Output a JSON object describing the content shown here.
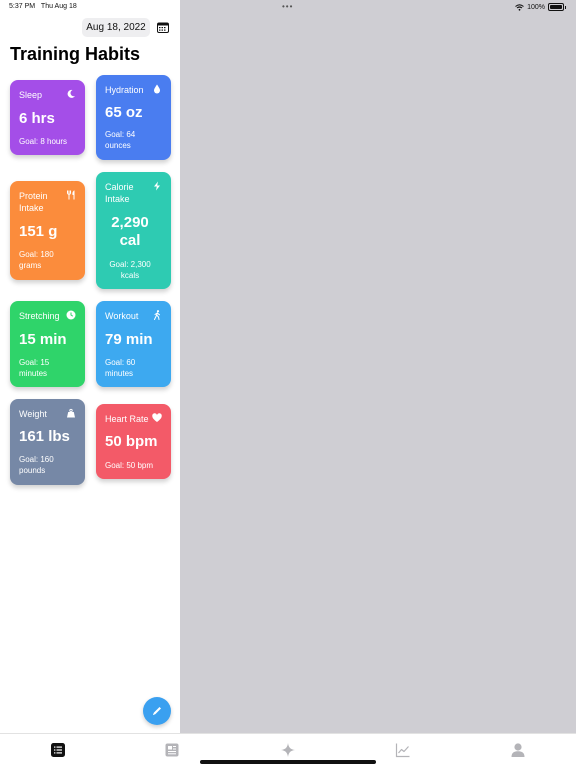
{
  "status_bar": {
    "time": "5:37 PM",
    "date": "Thu Aug 18",
    "battery": "100%"
  },
  "header": {
    "date": "Aug 18, 2022",
    "title": "Training Habits"
  },
  "cards": {
    "sleep": {
      "label": "Sleep",
      "value": "6 hrs",
      "goal": "Goal: 8 hours",
      "color": "#a44ee8",
      "icon": "moon-icon"
    },
    "hydration": {
      "label": "Hydration",
      "value": "65 oz",
      "goal": "Goal: 64 ounces",
      "color": "#4a7df0",
      "icon": "water-drop-icon"
    },
    "protein": {
      "label": "Protein Intake",
      "value": "151 g",
      "goal": "Goal: 180 grams",
      "color": "#fb8c3c",
      "icon": "fork-knife-icon"
    },
    "calorie": {
      "label": "Calorie Intake",
      "value": "2,290 cal",
      "goal": "Goal: 2,300 kcals",
      "color": "#2ecbb2",
      "icon": "bolt-icon"
    },
    "stretching": {
      "label": "Stretching",
      "value": "15 min",
      "goal": "Goal: 15 minutes",
      "color": "#2fd46a",
      "icon": "timer-icon"
    },
    "workout": {
      "label": "Workout",
      "value": "79 min",
      "goal": "Goal: 60 minutes",
      "color": "#3da9f0",
      "icon": "walking-icon"
    },
    "weight": {
      "label": "Weight",
      "value": "161 lbs",
      "goal": "Goal: 160 pounds",
      "color": "#7688a6",
      "icon": "scale-icon"
    },
    "heart": {
      "label": "Heart Rate",
      "value": "50 bpm",
      "goal": "Goal: 50 bpm",
      "color": "#f35a68",
      "icon": "heart-icon"
    }
  },
  "tabs": [
    {
      "name": "list",
      "icon": "list-icon",
      "active": true
    },
    {
      "name": "journal",
      "icon": "newspaper-icon",
      "active": false
    },
    {
      "name": "sparkle",
      "icon": "sparkle-icon",
      "active": false
    },
    {
      "name": "charts",
      "icon": "chart-icon",
      "active": false
    },
    {
      "name": "profile",
      "icon": "person-icon",
      "active": false
    }
  ],
  "colors": {
    "accent": "#3aa0f0",
    "detail_background": "#cfced3"
  }
}
